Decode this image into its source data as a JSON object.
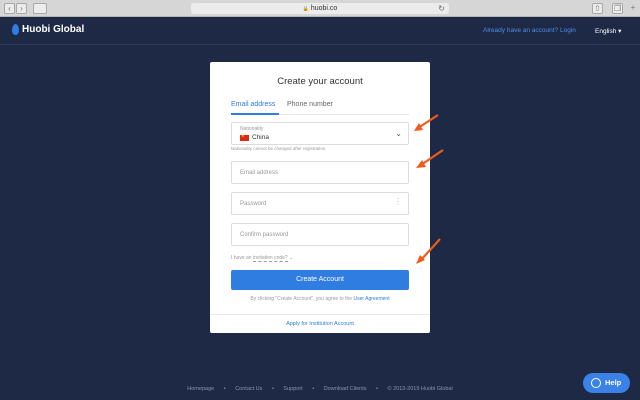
{
  "browser": {
    "url": "huobi.co",
    "lock_icon": "🔒"
  },
  "nav": {
    "logo": "Huobi Global",
    "login_link": "Already have an account? Login",
    "language": "English",
    "language_caret": "▾"
  },
  "form": {
    "title": "Create your account",
    "tabs": [
      "Email address",
      "Phone number"
    ],
    "nationality_label": "Nationality",
    "nationality_value": "China",
    "nationality_note": "Nationality cannot be changed after registration.",
    "email_placeholder": "Email address",
    "password_placeholder": "Password",
    "confirm_placeholder": "Confirm password",
    "invite_prefix": "I have an",
    "invite_link": "invitation code?",
    "submit": "Create Account",
    "agree_text": "By clicking \"Create Account\", you agree to the",
    "agree_link": "User Agreement",
    "institution_link": "Apply for Institution Account"
  },
  "footer": {
    "links": [
      "Homepage",
      "Contact Us",
      "Support",
      "Download Clients"
    ],
    "separator": "•",
    "copyright": "© 2013-2019 Huobi Global"
  },
  "help": {
    "label": "Help"
  },
  "colors": {
    "accent": "#2f7de1",
    "arrow": "#f05a1a",
    "background": "#1e2a45"
  }
}
